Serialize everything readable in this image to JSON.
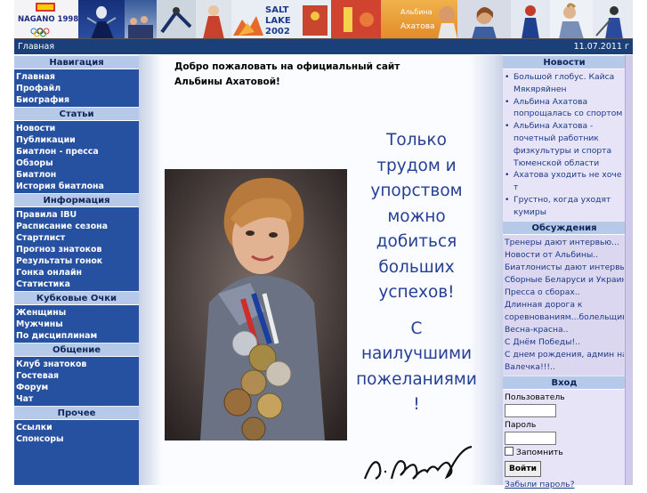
{
  "header": {
    "breadcrumb": "Главная",
    "date": "11.07.2011 г"
  },
  "banner": {
    "nagano_text": "NAGANO 1998",
    "saltlake_text1": "SALT",
    "saltlake_text2": "LAKE",
    "saltlake_text3": "2002",
    "name_text1": "Альбина",
    "name_text2": "Ахатова"
  },
  "left_nav": {
    "sections": [
      {
        "title": "Навигация",
        "items": [
          "Главная",
          "Профайл",
          "Биография"
        ]
      },
      {
        "title": "Статьи",
        "items": [
          "Новости",
          "Публикации",
          "Биатлон - пресса",
          "Обзоры",
          "Биатлон",
          "История биатлона"
        ]
      },
      {
        "title": "Информация",
        "items": [
          "Правила IBU",
          "Расписание сезона",
          "Стартлист",
          "Прогноз знатоков",
          "Результаты гонок",
          "Гонка онлайн",
          "Статистика"
        ]
      },
      {
        "title": "Кубковые Очки",
        "items": [
          "Женщины",
          "Мужчины",
          "По дисциплинам"
        ]
      },
      {
        "title": "Общение",
        "items": [
          "Клуб знатоков",
          "Гостевая",
          "Форум",
          "Чат"
        ]
      },
      {
        "title": "Прочее",
        "items": [
          "Ссылки",
          "Спонсоры"
        ]
      }
    ]
  },
  "main": {
    "welcome": "Добро пожаловать на официальный сайт Альбины Ахатовой!",
    "motto_lines": [
      "Только",
      "трудом и",
      "упорством",
      "можно",
      "добиться",
      "больших",
      "успехов!",
      "С",
      "наилучшими",
      "пожеланиями",
      "!"
    ],
    "signature": "А. Ахатова"
  },
  "right": {
    "news_title": "Новости",
    "news": [
      "Большой глобус. Кайса Мякяряйнен",
      "Альбина Ахатова попрощалась со спортом",
      "Альбина Ахатова - почетный работник физкультуры и спорта Тюменской области",
      "Ахатова уходить не хоче т",
      "Грустно, когда уходят кумиры"
    ],
    "discussions_title": "Обсуждения",
    "discussions": [
      "Тренеры дают интервью...",
      "Новости от Альбины..",
      "Биатлонисты дают интервью...",
      "Сборные Беларуси и Украины...",
      "Пресса о сборах..",
      "Длинная дорога к",
      "соревнованиям...болельщиков!..",
      "Весна-красна..",
      "С Днём Победы!..",
      "С днем рождения, админ наша",
      "Валечка!!!.."
    ],
    "login_title": "Вход",
    "user_label": "Пользователь",
    "pass_label": "Пароль",
    "remember_label": "Запомнить",
    "login_button": "Войти",
    "forgot_link": "Забыли пароль?"
  },
  "colors": {
    "nav_bg": "#2650a0",
    "header_bar": "#1b3f78",
    "section_header": "#b7c9e8",
    "motto": "#243f96",
    "right_bg": "#e8e4f7"
  }
}
